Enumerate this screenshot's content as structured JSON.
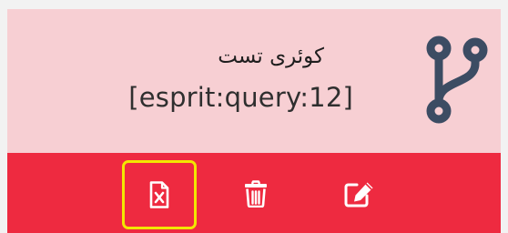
{
  "query_card": {
    "title": "کوئری تست",
    "identifier": "[esprit:query:12]",
    "icon": "code-branch-icon",
    "colors": {
      "card_background": "#f7cfd3",
      "action_bar": "#ee2a40",
      "branch_icon": "#3c4c63",
      "action_icons": "#ffffff",
      "focus_outline": "#f2e600"
    },
    "actions": [
      {
        "name": "export-excel",
        "icon": "file-excel-icon"
      },
      {
        "name": "delete",
        "icon": "trash-icon"
      },
      {
        "name": "edit",
        "icon": "edit-icon"
      }
    ]
  }
}
